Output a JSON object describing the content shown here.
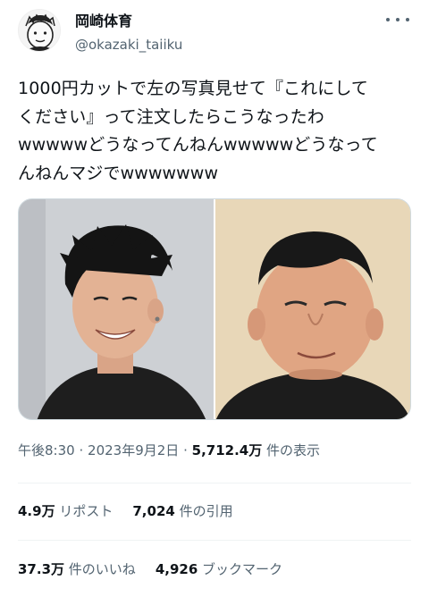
{
  "author": {
    "display_name": "岡崎体育",
    "handle": "@okazaki_taiiku",
    "avatar_icon": "illustrated-avatar"
  },
  "tweet": {
    "text_lines": [
      "1000円カットで左の写真見せて『これにして",
      "ください』って注文したらこうなったわ",
      "wwwwwどうなってんねんwwwwwどうなって",
      "んねんマジでwwwwwww"
    ]
  },
  "media": {
    "left_photo": "young-man-smiling-photo",
    "right_photo": "man-after-haircut-photo"
  },
  "meta": {
    "time": "午後8:30",
    "separator": "·",
    "date": "2023年9月2日",
    "views_count": "5,712.4万",
    "views_label": "件の表示"
  },
  "stats": {
    "reposts_count": "4.9万",
    "reposts_label": "リポスト",
    "quotes_count": "7,024",
    "quotes_label": "件の引用",
    "likes_count": "37.3万",
    "likes_label": "件のいいね",
    "bookmarks_count": "4,926",
    "bookmarks_label": "ブックマーク"
  }
}
